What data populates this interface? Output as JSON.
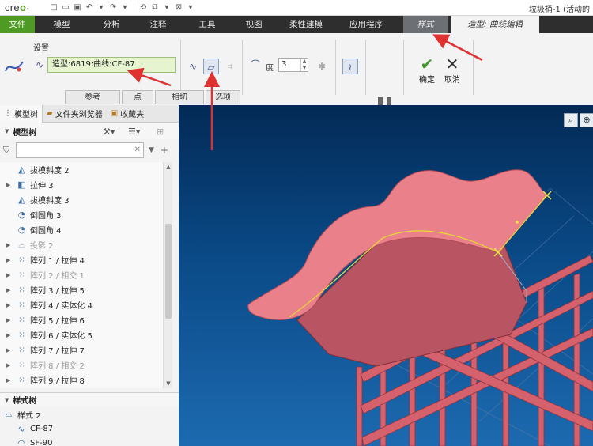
{
  "app": {
    "logo_prefix": "cre",
    "logo_suffix": "o",
    "window_title": "垃圾桶-1 (活动的"
  },
  "ribbon_tabs": [
    "文件",
    "模型",
    "分析",
    "注释",
    "工具",
    "视图",
    "柔性建模",
    "应用程序"
  ],
  "style_tab": "样式",
  "active_tab": "造型: 曲线编辑",
  "settings": {
    "group_label": "设置",
    "curve_reference": "造型:6819:曲线:CF-87",
    "degree_label": "度",
    "degree_value": "3"
  },
  "actions": {
    "ok_label": "确定",
    "cancel_label": "取消"
  },
  "sub_tabs": [
    "参考",
    "点",
    "相切",
    "选项"
  ],
  "nav_tabs": [
    "模型树",
    "文件夹浏览器",
    "收藏夹"
  ],
  "model_tree": {
    "header": "模型树",
    "filter_placeholder": "",
    "items": [
      {
        "label": "拔模斜度 2",
        "expand": false,
        "dim": false,
        "icon": "draft-icon"
      },
      {
        "label": "拉伸 3",
        "expand": true,
        "dim": false,
        "icon": "extrude-icon"
      },
      {
        "label": "拔模斜度 3",
        "expand": false,
        "dim": false,
        "icon": "draft-icon"
      },
      {
        "label": "倒圆角 3",
        "expand": false,
        "dim": false,
        "icon": "round-icon"
      },
      {
        "label": "倒圆角 4",
        "expand": false,
        "dim": false,
        "icon": "round-icon"
      },
      {
        "label": "投影 2",
        "expand": true,
        "dim": true,
        "icon": "project-icon"
      },
      {
        "label": "阵列 1 / 拉伸 4",
        "expand": true,
        "dim": false,
        "icon": "pattern-icon"
      },
      {
        "label": "阵列 2 / 相交 1",
        "expand": true,
        "dim": true,
        "icon": "pattern-icon"
      },
      {
        "label": "阵列 3 / 拉伸 5",
        "expand": true,
        "dim": false,
        "icon": "pattern-icon"
      },
      {
        "label": "阵列 4 / 实体化 4",
        "expand": true,
        "dim": false,
        "icon": "pattern-icon"
      },
      {
        "label": "阵列 5 / 拉伸 6",
        "expand": true,
        "dim": false,
        "icon": "pattern-icon"
      },
      {
        "label": "阵列 6 / 实体化 5",
        "expand": true,
        "dim": false,
        "icon": "pattern-icon"
      },
      {
        "label": "阵列 7 / 拉伸 7",
        "expand": true,
        "dim": false,
        "icon": "pattern-icon"
      },
      {
        "label": "阵列 8 / 相交 2",
        "expand": true,
        "dim": true,
        "icon": "pattern-icon"
      },
      {
        "label": "阵列 9 / 拉伸 8",
        "expand": true,
        "dim": false,
        "icon": "pattern-icon"
      }
    ]
  },
  "style_tree": {
    "header": "样式树",
    "root": "样式 2",
    "children": [
      "CF-87",
      "SF-90"
    ]
  },
  "colors": {
    "file_tab": "#4f9a24",
    "ribbon_bar": "#2e2e2e",
    "curve_ref_bg": "#e6f5cf",
    "viewport_top": "#032a56",
    "viewport_bottom": "#1d6ab0",
    "model_surface": "#e7737e",
    "annotation_arrow": "#e03131"
  }
}
